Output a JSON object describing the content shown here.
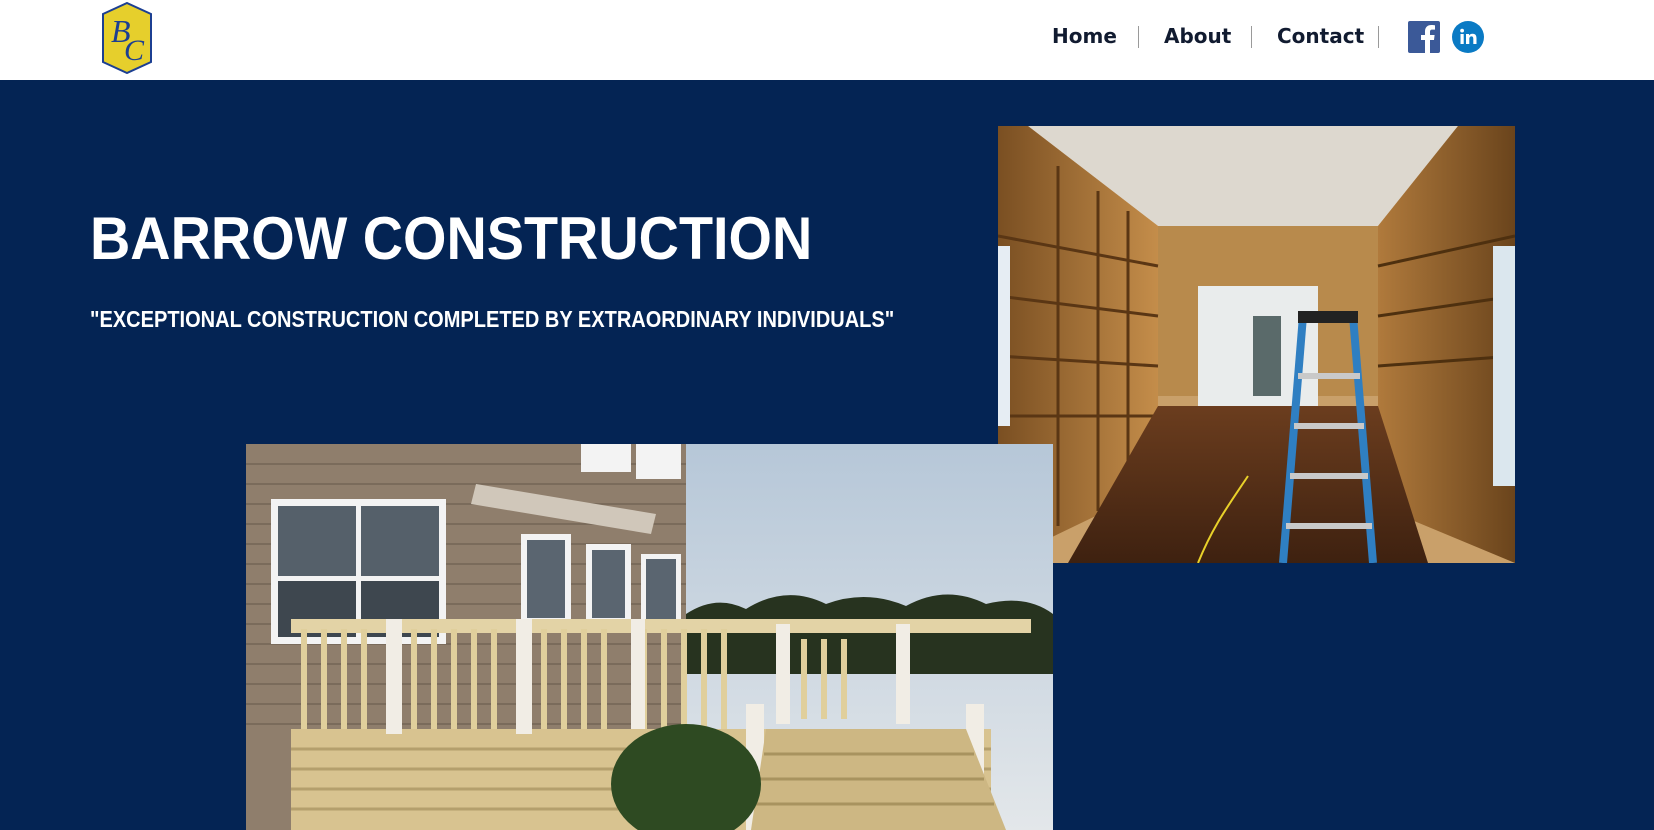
{
  "header": {
    "logo_letters": "BC",
    "nav": [
      {
        "label": "Home"
      },
      {
        "label": "About"
      },
      {
        "label": "Contact"
      }
    ],
    "social": [
      {
        "icon": "facebook-icon",
        "color": "#3b5998"
      },
      {
        "icon": "linkedin-icon",
        "color": "#0a7ac4"
      }
    ]
  },
  "hero": {
    "title": "BARROW CONSTRUCTION",
    "tagline": "\"EXCEPTIONAL CONSTRUCTION COMPLETED BY EXTRAORDINARY INDIVIDUALS\""
  },
  "colors": {
    "brand_navy": "#042454",
    "logo_yellow": "#e6cf2c",
    "logo_blue": "#1c3f92"
  }
}
